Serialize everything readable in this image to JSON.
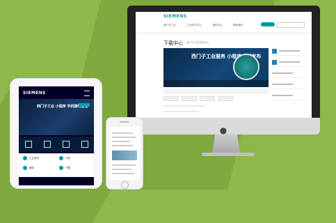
{
  "imac_site": {
    "brand": "SIEMENS",
    "nav": [
      "西门子工业",
      "工业学习中心",
      "资料中心",
      "联系我们"
    ],
    "page_title": "下载中心",
    "page_subtitle": "— 西门子工业支持中心",
    "banner_text": "西门子工业服务 小程序全新发布"
  },
  "ipad_site": {
    "brand": "SIEMENS",
    "hero_text": "西门子工业 小程序 手机随时查看",
    "tiles": [
      "工业资讯",
      "产品",
      "服务",
      "下载"
    ]
  },
  "colors": {
    "background": "#8db84a",
    "brand_teal": "#009999",
    "dark_navy": "#000028"
  }
}
